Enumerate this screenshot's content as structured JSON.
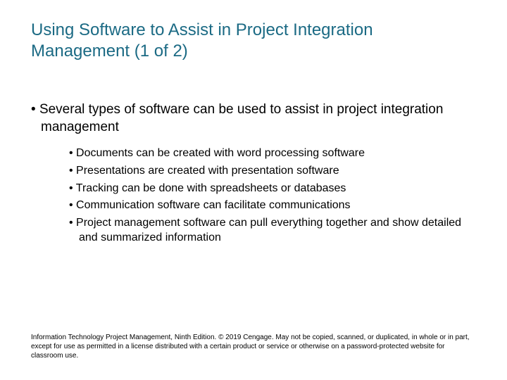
{
  "title": "Using Software to Assist in Project Integration Management (1 of 2)",
  "main_bullet": "Several types of software can be used to assist in project integration management",
  "sub_bullets": [
    "Documents can be created with word processing software",
    "Presentations are created with presentation software",
    "Tracking can be done with spreadsheets or databases",
    "Communication software can facilitate communications",
    "Project management software can pull everything together and show detailed and summarized information"
  ],
  "footer": "Information Technology Project Management, Ninth Edition. © 2019 Cengage. May not be copied, scanned, or duplicated, in whole or in part, except for use as permitted in a license distributed with a certain product or service or otherwise on a password-protected website for classroom use."
}
